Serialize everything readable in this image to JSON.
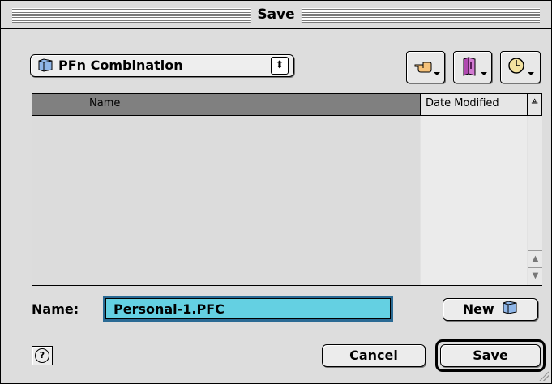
{
  "window": {
    "title": "Save"
  },
  "folder_popup": {
    "label": "PFn Combination",
    "icon": "folder-icon"
  },
  "toolbar": {
    "buttons": [
      {
        "name": "shortcuts-button",
        "icon": "pointing-hand-icon"
      },
      {
        "name": "favorites-button",
        "icon": "favorites-book-icon"
      },
      {
        "name": "recent-button",
        "icon": "clock-icon"
      }
    ]
  },
  "file_list": {
    "columns": [
      "Name",
      "Date Modified"
    ],
    "sort_glyph": "≜",
    "rows": []
  },
  "name_field": {
    "label": "Name:",
    "value": "Personal-1.PFC"
  },
  "buttons": {
    "new": "New",
    "cancel": "Cancel",
    "save": "Save"
  },
  "colors": {
    "selection": "#64d0e2",
    "window_bg": "#dddddd"
  }
}
